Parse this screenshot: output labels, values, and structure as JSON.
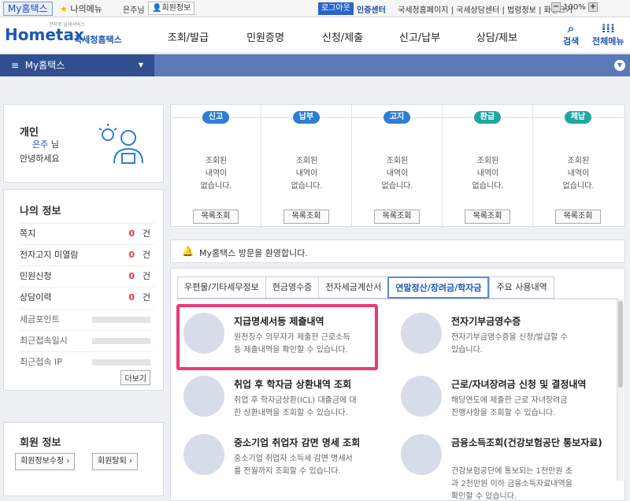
{
  "topbar": {
    "my_hometax": "My홈택스",
    "my_menu": "나의메뉴",
    "user_name": "은주님",
    "user_info": "회원정보",
    "logout": "로그아웃",
    "cert_center": "인증센터",
    "links": [
      "국세청홈페이지",
      "국세상담센터",
      "법령정보",
      "화면크기"
    ],
    "zoom": "100%"
  },
  "header": {
    "logo_small": "전자로 납세서비스",
    "logo_text": "Hometax",
    "logo_sub": "국세청홈택스",
    "nav": [
      "조회/발급",
      "민원증명",
      "신청/제출",
      "신고/납부",
      "상담/제보"
    ],
    "search_label": "검색",
    "all_menu_label": "전체메뉴"
  },
  "mybar": {
    "title": "My홈택스"
  },
  "user_panel": {
    "type": "개인",
    "name": "은주",
    "suffix": "님",
    "greeting": "안녕하세요"
  },
  "my_info": {
    "title": "나의 정보",
    "rows": [
      {
        "label": "쪽지",
        "count": "0",
        "unit": "건"
      },
      {
        "label": "전자고지 미열람",
        "count": "0",
        "unit": "건"
      },
      {
        "label": "민원신청",
        "count": "0",
        "unit": "건"
      },
      {
        "label": "상담이력",
        "count": "0",
        "unit": "건"
      }
    ],
    "extra_rows": [
      "세금포인트",
      "최근접속일시",
      "최근접속 IP"
    ],
    "more": "더보기"
  },
  "member_info": {
    "title": "회원 정보",
    "edit": "회원정보수정",
    "withdraw": "회원탈퇴"
  },
  "status": [
    {
      "badge": "신고",
      "color": "#2e7dd7",
      "msg": "조회된\n내역이\n없습니다.",
      "btn": "목록조회"
    },
    {
      "badge": "납부",
      "color": "#2e7dd7",
      "msg": "조회된\n내역이\n없습니다.",
      "btn": "목록조회"
    },
    {
      "badge": "고지",
      "color": "#2e7dd7",
      "msg": "조회된\n내역이\n없습니다.",
      "btn": "목록조회"
    },
    {
      "badge": "환급",
      "color": "#20a6a0",
      "msg": "조회된\n내역이\n없습니다.",
      "btn": "목록조회"
    },
    {
      "badge": "체납",
      "color": "#20a6a0",
      "msg": "조회된\n내역이\n없습니다.",
      "btn": "목록조회"
    }
  ],
  "notice": "My홈택스 방문을 환영합니다.",
  "tabs": [
    "우편물/기타세무정보",
    "현금영수증",
    "전자세금계산서",
    "연말정산/장려금/학자금",
    "주요 사용내역"
  ],
  "items": [
    {
      "title": "지급명세서등 제출내역",
      "desc": "원천징수 의무자가 제출한 근로소득\n등 제출내역을 확인할 수 있습니다."
    },
    {
      "title": "전자기부금영수증",
      "desc": "전자기부금영수증을 신청/발급할 수\n있습니다."
    },
    {
      "title": "취업 후 학자금 상환내역 조회",
      "desc": "취업 후 학자금상환(ICL) 대출금에 대\n한 상환내역을 조회할 수 있습니다."
    },
    {
      "title": "근로/자녀장려금 신청 및 결정내역",
      "desc": "해당연도에 제출한 근로 자녀장려금\n진행사항을 조회할 수 있습니다."
    },
    {
      "title": "중소기업 취업자 감면 명세 조회",
      "desc": "중소기업 취업자 소득세 감면 명세서\n를 전월까지 조회할 수 있습니다."
    },
    {
      "title": "금융소득조회(건강보험공단 통보자료)",
      "desc": "건강보험공단에 통보되는 1천만원 초\n과 2천만원 이하 금융소득자료내역을\n확인할 수 있습니다."
    }
  ]
}
